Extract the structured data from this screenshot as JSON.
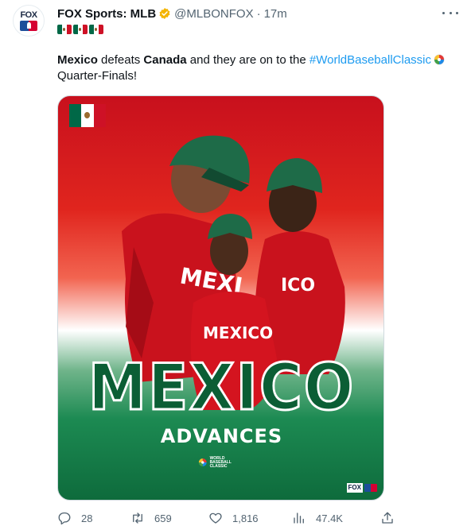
{
  "tweet": {
    "author": {
      "display_name": "FOX Sports: MLB",
      "handle": "@MLBONFOX",
      "separator": "·",
      "time": "17m",
      "avatar_text": "FOX",
      "verified_color": "#f4b400"
    },
    "flag_emoji_count": 3,
    "text": {
      "team1": "Mexico",
      "part1": " defeats ",
      "team2": "Canada",
      "part2": " and they are on to the ",
      "hashtag": "#WorldBaseballClassic",
      "part3": "Quarter-Finals!"
    },
    "media": {
      "headline": "MEXICO",
      "subheadline": "ADVANCES",
      "event_logo_text": "WORLD BASEBALL CLASSIC",
      "broadcaster_text": "FOX"
    },
    "actions": {
      "replies": "28",
      "retweets": "659",
      "likes": "1,816",
      "views": "47.4K"
    }
  },
  "colors": {
    "text": "#0f1419",
    "secondary": "#536471",
    "link": "#1d9bf0",
    "mexico_green": "#006847",
    "mexico_red": "#ce1126"
  }
}
